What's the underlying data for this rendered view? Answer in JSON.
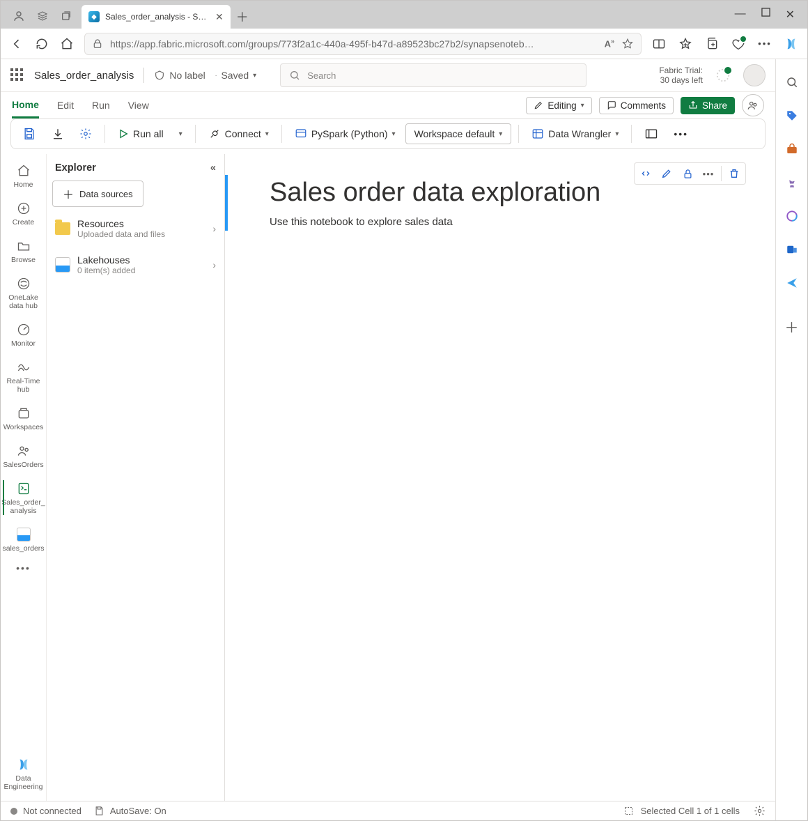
{
  "browser": {
    "tab_title": "Sales_order_analysis - Synapse D",
    "url_display": "https://app.fabric.microsoft.com/groups/773f2a1c-440a-495f-b47d-a89523bc27b2/synapsenoteb…"
  },
  "header": {
    "doc_name": "Sales_order_analysis",
    "label": "No label",
    "saved": "Saved",
    "search_placeholder": "Search",
    "trial_line1": "Fabric Trial:",
    "trial_line2": "30 days left"
  },
  "ribbon_tabs": {
    "home": "Home",
    "edit": "Edit",
    "run": "Run",
    "view": "View"
  },
  "ribbon_buttons": {
    "editing": "Editing",
    "comments": "Comments",
    "share": "Share"
  },
  "toolbar": {
    "run_all": "Run all",
    "connect": "Connect",
    "language": "PySpark (Python)",
    "environment": "Workspace default",
    "data_wrangler": "Data Wrangler"
  },
  "left_rail": {
    "home": "Home",
    "create": "Create",
    "browse": "Browse",
    "onelake": "OneLake data hub",
    "monitor": "Monitor",
    "realtime": "Real-Time hub",
    "workspaces": "Workspaces",
    "salesorders": "SalesOrders",
    "analysis": "Sales_order_\nanalysis",
    "sales_orders": "sales_orders",
    "persona": "Data Engineering"
  },
  "explorer": {
    "title": "Explorer",
    "data_sources": "Data sources",
    "resources": {
      "title": "Resources",
      "sub": "Uploaded data and files"
    },
    "lakehouses": {
      "title": "Lakehouses",
      "sub": "0 item(s) added"
    }
  },
  "cell": {
    "heading": "Sales order data exploration",
    "body": "Use this notebook to explore sales data"
  },
  "status": {
    "connection": "Not connected",
    "autosave": "AutoSave: On",
    "selection": "Selected Cell 1 of 1 cells"
  }
}
